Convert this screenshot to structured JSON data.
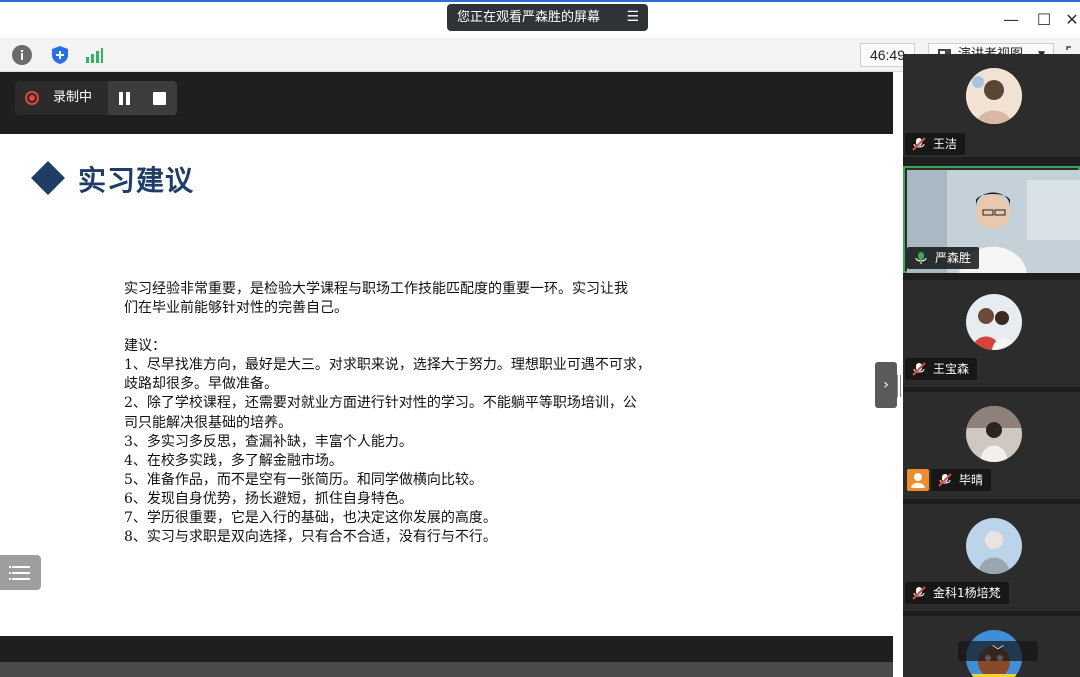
{
  "window": {
    "sharing_banner": "您正在观看严森胜的屏幕",
    "minimize_glyph": "—",
    "maximize_glyph": "☐",
    "close_glyph": "✕"
  },
  "toolbar": {
    "info_icon": "info-icon",
    "security_icon": "shield-icon",
    "signal_icon": "signal-bars-icon",
    "timer": "46:49",
    "view_label": "演讲者视图"
  },
  "recording": {
    "label": "录制中"
  },
  "slide": {
    "title": "实习建议",
    "intro": [
      "实习经验非常重要，是检验大学课程与职场工作技能匹配度的重要一环。实习让我",
      "们在毕业前能够针对性的完善自己。"
    ],
    "advice_heading": "建议：",
    "advice": [
      "1、尽早找准方向，最好是大三。对求职来说，选择大于努力。理想职业可遇不可求，",
      "歧路却很多。早做准备。",
      "2、除了学校课程，还需要对就业方面进行针对性的学习。不能躺平等职场培训，公",
      "司只能解决很基础的培养。",
      "3、多实习多反思，查漏补缺，丰富个人能力。",
      "4、在校多实践，多了解金融市场。",
      "5、准备作品，而不是空有一张简历。和同学做横向比较。",
      "6、发现自身优势，扬长避短，抓住自身特色。",
      "7、学历很重要，它是入行的基础，也决定这你发展的高度。",
      "8、实习与求职是双向选择，只有合不合适，没有行与不行。"
    ]
  },
  "participants": [
    {
      "name": "王洁",
      "muted": true
    },
    {
      "name": "严森胜",
      "muted": false,
      "speaking": true
    },
    {
      "name": "王宝森",
      "muted": true
    },
    {
      "name": "毕晴",
      "muted": true
    },
    {
      "name": "金科1杨培梵",
      "muted": true
    }
  ],
  "colors": {
    "accent_blue": "#1f3d66",
    "record_red": "#e0453a",
    "active_green": "#3aa757",
    "muted_red": "#e04848"
  }
}
